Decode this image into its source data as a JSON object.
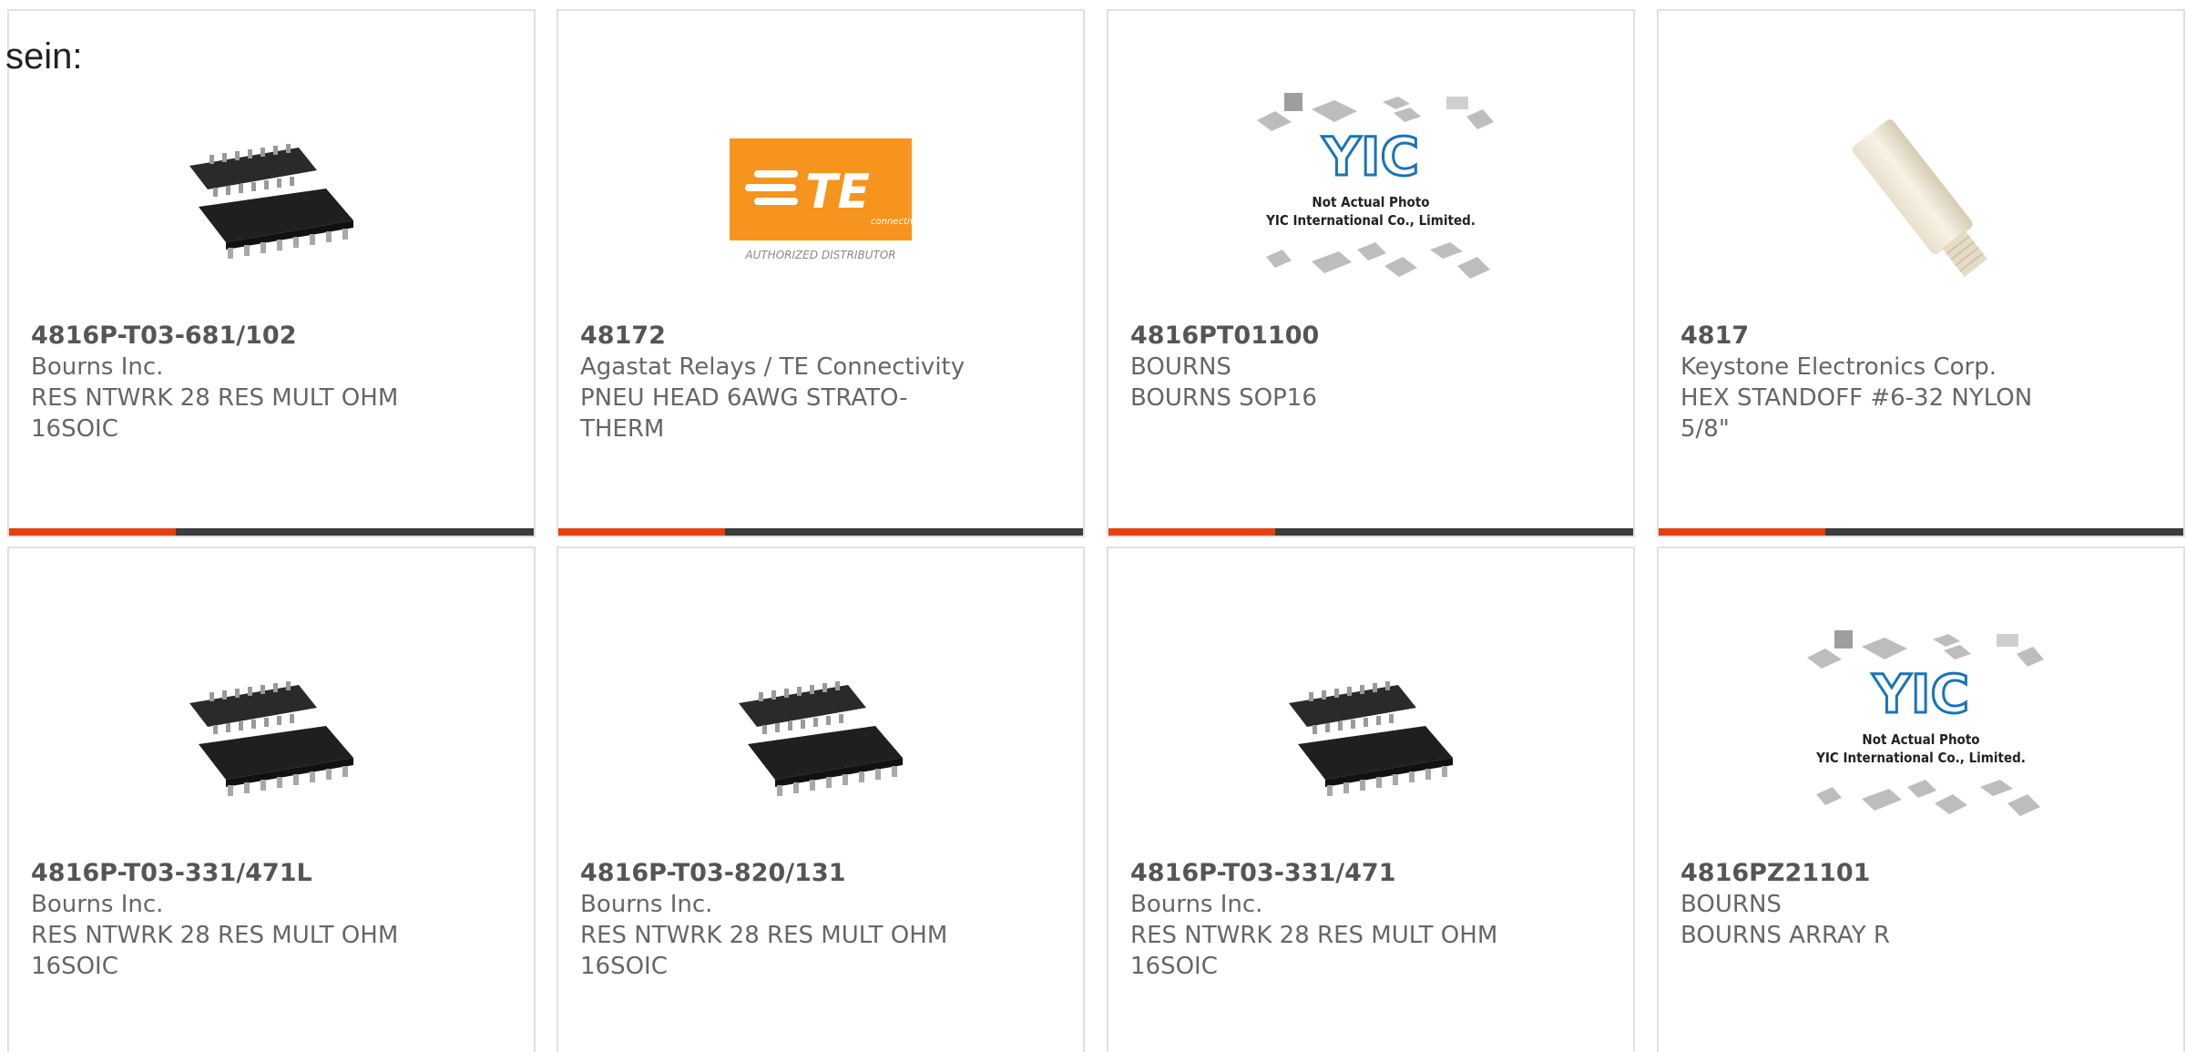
{
  "header_fragment": "sein:",
  "products": [
    {
      "part_number": "4816P-T03-681/102",
      "manufacturer": "Bourns Inc.",
      "description": "RES NTWRK 28 RES MULT OHM 16SOIC",
      "image": "soic-chip-icon"
    },
    {
      "part_number": "48172",
      "manufacturer": "Agastat Relays / TE Connectivity",
      "description": "PNEU HEAD 6AWG STRATO-THERM",
      "image": "te-logo",
      "logo_caption": "AUTHORIZED DISTRIBUTOR",
      "logo_sub": "connectivity"
    },
    {
      "part_number": "4816PT01100",
      "manufacturer": "BOURNS",
      "description": "BOURNS SOP16",
      "image": "yic-placeholder-icon",
      "placeholder_line1": "Not Actual Photo",
      "placeholder_line2": "YIC International Co., Limited."
    },
    {
      "part_number": "4817",
      "manufacturer": "Keystone Electronics Corp.",
      "description": "HEX STANDOFF #6-32 NYLON 5/8\"",
      "image": "nylon-standoff-icon"
    },
    {
      "part_number": "4816P-T03-331/471L",
      "manufacturer": "Bourns Inc.",
      "description": "RES NTWRK 28 RES MULT OHM 16SOIC",
      "image": "soic-chip-icon"
    },
    {
      "part_number": "4816P-T03-820/131",
      "manufacturer": "Bourns Inc.",
      "description": "RES NTWRK 28 RES MULT OHM 16SOIC",
      "image": "soic-chip-icon"
    },
    {
      "part_number": "4816P-T03-331/471",
      "manufacturer": "Bourns Inc.",
      "description": "RES NTWRK 28 RES MULT OHM 16SOIC",
      "image": "soic-chip-icon"
    },
    {
      "part_number": "4816PZ21101",
      "manufacturer": "BOURNS",
      "description": "BOURNS ARRAY R",
      "image": "yic-placeholder-icon",
      "placeholder_line1": "Not Actual Photo",
      "placeholder_line2": "YIC International Co., Limited."
    }
  ],
  "colors": {
    "accent": "#e6400f",
    "bar": "#3c3c3c",
    "te_orange": "#f7941d",
    "yic_blue": "#1a73b8"
  }
}
